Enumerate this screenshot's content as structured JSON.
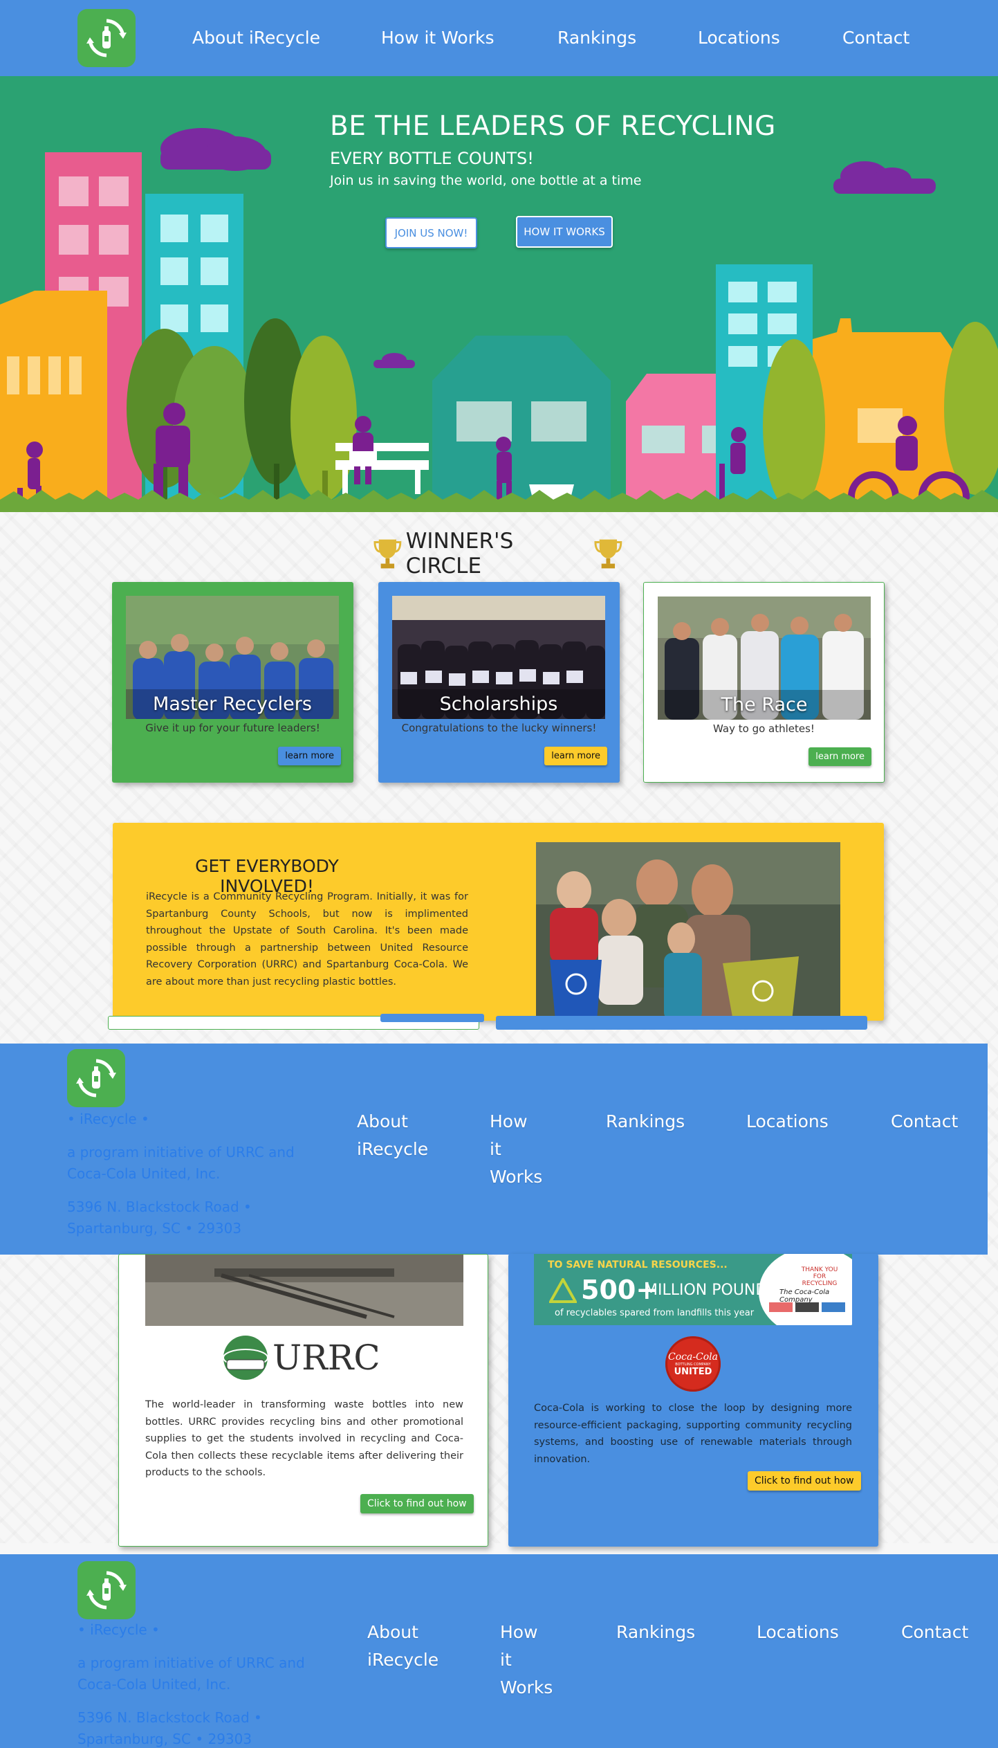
{
  "colors": {
    "nav_blue": "#4a8fe0",
    "hero_green": "#2ba272",
    "card_green": "#4caf50",
    "card_blue": "#4a8fe0",
    "involved_yellow": "#fdcb2b",
    "brand_link": "#2b7de9",
    "button_yellow": "#fdcb2b"
  },
  "header": {
    "logo_icon": "recycle-bottle-icon",
    "nav": [
      "About iRecycle",
      "How it Works",
      "Rankings",
      "Locations",
      "Contact"
    ]
  },
  "hero": {
    "title": "BE THE LEADERS OF RECYCLING",
    "subtitle": "EVERY BOTTLE COUNTS!",
    "tagline": "Join us in saving the world, one bottle at a time",
    "join_label": "JOIN US NOW!",
    "how_label": "HOW IT WORKS"
  },
  "winners": {
    "title": "WINNER'S CIRCLE",
    "trophy_icon": "trophy-icon",
    "cards": [
      {
        "caption": "Master Recyclers",
        "desc": "Give it up for your future leaders!",
        "button": "learn more"
      },
      {
        "caption": "Scholarships",
        "desc": "Congratulations to the lucky winners!",
        "button": "learn more"
      },
      {
        "caption": "The Race",
        "desc": "Way to go athletes!",
        "button": "learn more"
      }
    ]
  },
  "involved": {
    "title": "GET EVERYBODY INVOLVED!",
    "body": "iRecycle is a Community Recycling Program. Initially, it was for Spartanburg County Schools, but now is implimented throughout the Upstate of South Carolina. It's been made possible through a partnership between United Resource Recovery Corporation (URRC) and Spartanburg Coca-Cola. We are about more than just recycling plastic bottles."
  },
  "footer": {
    "brand": "• iRecycle •",
    "initiative": "a program initiative of URRC and Coca-Cola United, Inc.",
    "address": "5396 N. Blackstock Road • Spartanburg, SC • 29303",
    "nav": [
      "About iRecycle",
      "How it Works",
      "Rankings",
      "Locations",
      "Contact"
    ]
  },
  "partners": {
    "urrc": {
      "logo_text": "URRC",
      "body": "The world-leader in transforming waste bottles into new bottles. URRC provides recycling bins and other promotional supplies to get the students involved in recycling and Coca-Cola then collects these recyclable items after delivering their products to the schools.",
      "button": "Click to find out how"
    },
    "coke": {
      "banner_top": "TO SAVE NATURAL RESOURCES...",
      "banner_big": "500+",
      "banner_unit": "MILLION POUNDS",
      "banner_small": "of recyclables spared from landfills this year",
      "banner_thanks": "THANK YOU FOR RECYCLING",
      "banner_brand": "The Coca-Cola Company",
      "logo_text": "Coca-Cola",
      "logo_sub": "BOTTLING COMPANY",
      "logo_united": "UNITED",
      "body": "Coca-Cola is working to close the loop by designing more resource-efficient packaging, supporting community recycling systems, and boosting use of renewable materials through innovation.",
      "button": "Click to find out how"
    }
  }
}
